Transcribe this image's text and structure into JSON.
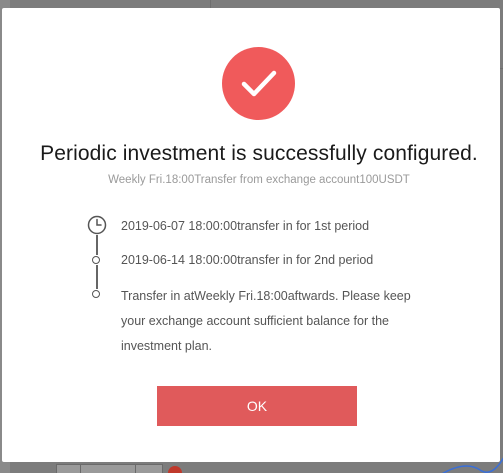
{
  "dialog": {
    "title": "Periodic investment is successfully configured.",
    "subtitle": "Weekly Fri.18:00Transfer from exchange account100USDT",
    "icon": "checkmark-success-icon",
    "accent_color": "#f05a5b",
    "timeline": [
      {
        "icon": "clock-icon",
        "text": "2019-06-07 18:00:00transfer in for 1st period"
      },
      {
        "icon": "dot-icon",
        "text": "2019-06-14 18:00:00transfer in for 2nd period"
      },
      {
        "icon": "dot-icon",
        "text": "Transfer in atWeekly Fri.18:00aftwards. Please keep your exchange account sufficient balance for the investment plan."
      }
    ],
    "ok_label": "OK",
    "button_color": "#e05a5b"
  }
}
